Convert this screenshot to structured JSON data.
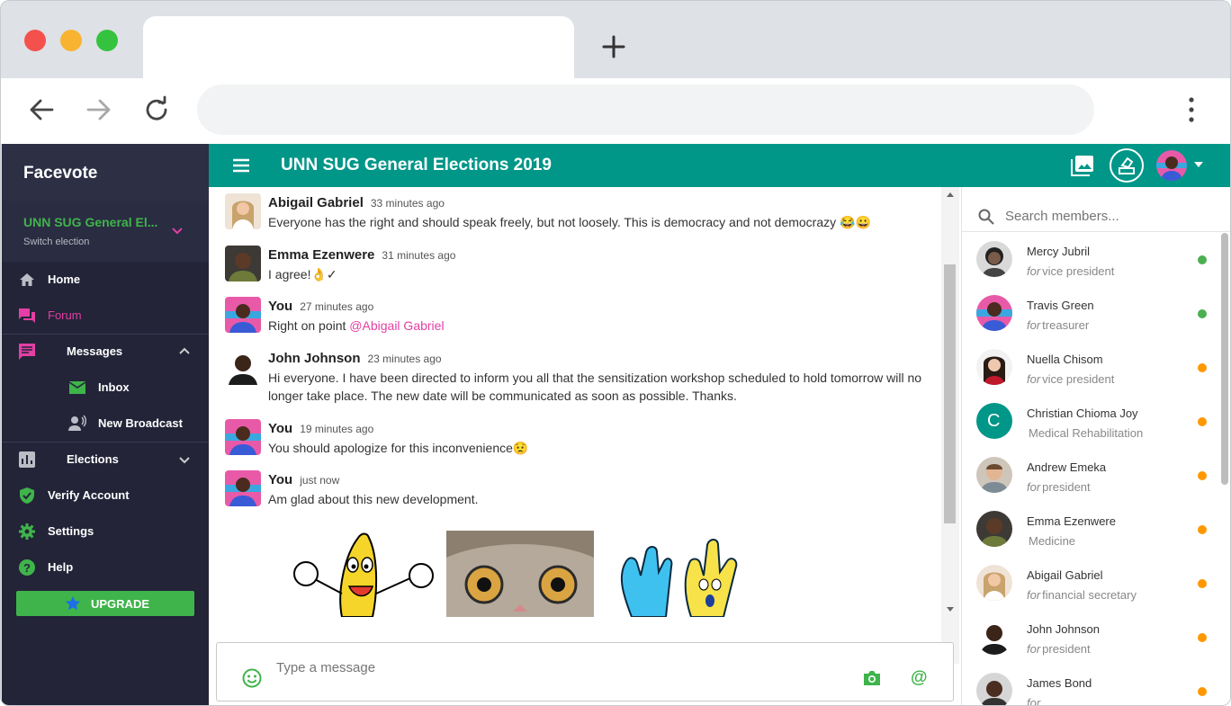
{
  "browser": {
    "url": ""
  },
  "app": {
    "brand": "Facevote",
    "election": {
      "name": "UNN SUG General El...",
      "sub": "Switch election"
    },
    "menu": {
      "home": "Home",
      "forum": "Forum",
      "messages": "Messages",
      "inbox": "Inbox",
      "broadcast": "New Broadcast",
      "elections": "Elections",
      "verify": "Verify Account",
      "settings": "Settings",
      "help": "Help",
      "upgrade": "UPGRADE"
    },
    "header_title": "UNN SUG General Elections 2019"
  },
  "messages": [
    {
      "name": "Abigail Gabriel",
      "time": "33 minutes ago",
      "text": "Everyone has the right and should speak freely, but not loosely. This is democracy and not democrazy 😂😀"
    },
    {
      "name": "Emma Ezenwere",
      "time": "31 minutes ago",
      "text": "I agree!👌✓"
    },
    {
      "name": "You",
      "time": "27 minutes ago",
      "text": "Right on point ",
      "mention": "@Abigail Gabriel"
    },
    {
      "name": "John Johnson",
      "time": "23 minutes ago",
      "text": "Hi everyone. I have been directed to inform you all that the sensitization workshop scheduled to hold tomorrow will no longer take place. The new date will be communicated as soon as possible. Thanks."
    },
    {
      "name": "You",
      "time": "19 minutes ago",
      "text": "You should apologize for this inconvenience😟"
    },
    {
      "name": "You",
      "time": "just now",
      "text": "Am glad about this new development."
    }
  ],
  "composer": {
    "placeholder": "Type a message"
  },
  "members": {
    "search_placeholder": "Search members...",
    "list": [
      {
        "name": "Mercy Jubril",
        "for": "for",
        "role": "vice president",
        "status_color": "#4caf50"
      },
      {
        "name": "Travis Green",
        "for": "for",
        "role": "treasurer",
        "status_color": "#4caf50"
      },
      {
        "name": "Nuella Chisom",
        "for": "for",
        "role": "vice president",
        "status_color": "#ff9800"
      },
      {
        "name": "Christian Chioma Joy",
        "for": "",
        "role": "Medical Rehabilitation",
        "status_color": "#ff9800",
        "initial": "C"
      },
      {
        "name": "Andrew Emeka",
        "for": "for",
        "role": "president",
        "status_color": "#ff9800"
      },
      {
        "name": "Emma Ezenwere",
        "for": "",
        "role": "Medicine",
        "status_color": "#ff9800"
      },
      {
        "name": "Abigail Gabriel",
        "for": "for",
        "role": "financial secretary",
        "status_color": "#ff9800"
      },
      {
        "name": "John Johnson",
        "for": "for",
        "role": "president",
        "status_color": "#ff9800"
      },
      {
        "name": "James Bond",
        "for": "for",
        "role": "",
        "status_color": "#ff9800"
      }
    ]
  },
  "colors": {
    "accent": "#009688",
    "success": "#3fb44b",
    "pink": "#e33fa4",
    "sidebar": "#232438"
  }
}
